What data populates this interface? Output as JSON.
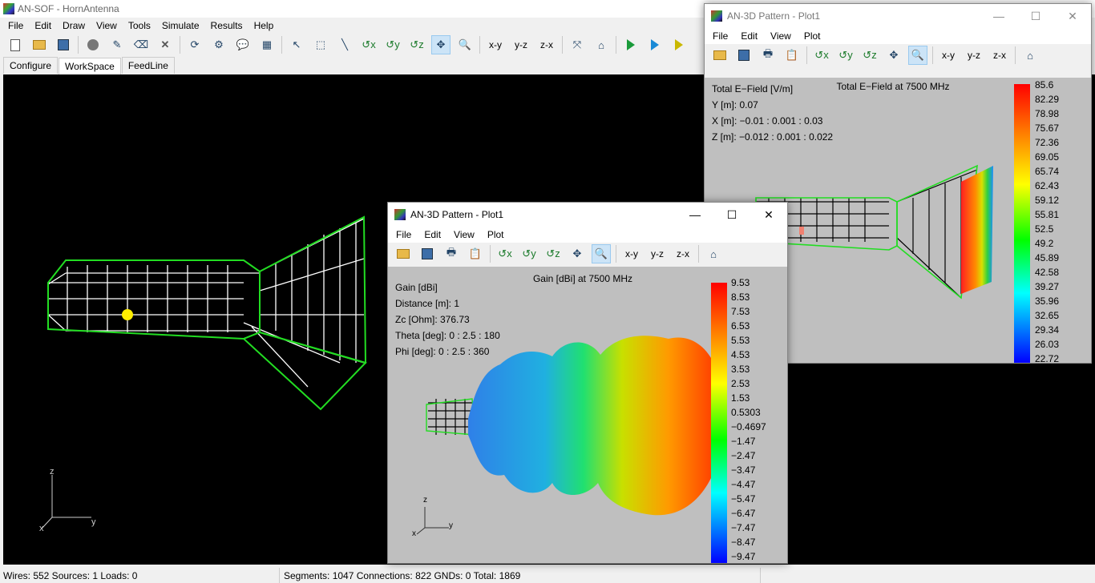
{
  "app": {
    "title": "AN-SOF - HornAntenna",
    "menu": [
      "File",
      "Edit",
      "Draw",
      "View",
      "Tools",
      "Simulate",
      "Results",
      "Help"
    ],
    "toolbar_text": [
      "x-y",
      "y-z",
      "z-x"
    ],
    "tabs": [
      "Configure",
      "WorkSpace",
      "FeedLine"
    ],
    "active_tab": "WorkSpace",
    "axis_labels": {
      "z": "z",
      "x": "x",
      "y": "y"
    }
  },
  "status": {
    "left": "Wires: 552  Sources: 1  Loads: 0",
    "right": "Segments: 1047  Connections: 822  GNDs: 0  Total: 1869"
  },
  "plot_window_back": {
    "title": "AN-3D Pattern - Plot1",
    "menu": [
      "File",
      "Edit",
      "View",
      "Plot"
    ],
    "toolbar_text": [
      "x-y",
      "y-z",
      "z-x"
    ],
    "plot_title": "Total E−Field at 7500 MHz",
    "info": [
      "Total E−Field [V/m]",
      "Y [m]: 0.07",
      "X [m]: −0.01 : 0.001 : 0.03",
      "Z [m]: −0.012 : 0.001 : 0.022"
    ],
    "colorbar": [
      "85.6",
      "82.29",
      "78.98",
      "75.67",
      "72.36",
      "69.05",
      "65.74",
      "62.43",
      "59.12",
      "55.81",
      "52.5",
      "49.2",
      "45.89",
      "42.58",
      "39.27",
      "35.96",
      "32.65",
      "29.34",
      "26.03",
      "22.72"
    ]
  },
  "plot_window_front": {
    "title": "AN-3D Pattern - Plot1",
    "menu": [
      "File",
      "Edit",
      "View",
      "Plot"
    ],
    "toolbar_text": [
      "x-y",
      "y-z",
      "z-x"
    ],
    "plot_title": "Gain [dBi] at 7500 MHz",
    "info": [
      "Gain [dBi]",
      "Distance [m]: 1",
      "Zc [Ohm]: 376.73",
      "Theta [deg]: 0 : 2.5 : 180",
      "Phi [deg]: 0 : 2.5 : 360"
    ],
    "colorbar": [
      "9.53",
      "8.53",
      "7.53",
      "6.53",
      "5.53",
      "4.53",
      "3.53",
      "2.53",
      "1.53",
      "0.5303",
      "−0.4697",
      "−1.47",
      "−2.47",
      "−3.47",
      "−4.47",
      "−5.47",
      "−6.47",
      "−7.47",
      "−8.47",
      "−9.47"
    ],
    "axis_labels": {
      "z": "z",
      "x": "x",
      "y": "y"
    }
  },
  "colors": {
    "wire": "#ffffff",
    "outline": "#22dd22",
    "source": "#ffee00",
    "workspace_bg": "#000000",
    "plot_bg": "#bfbfbf"
  }
}
